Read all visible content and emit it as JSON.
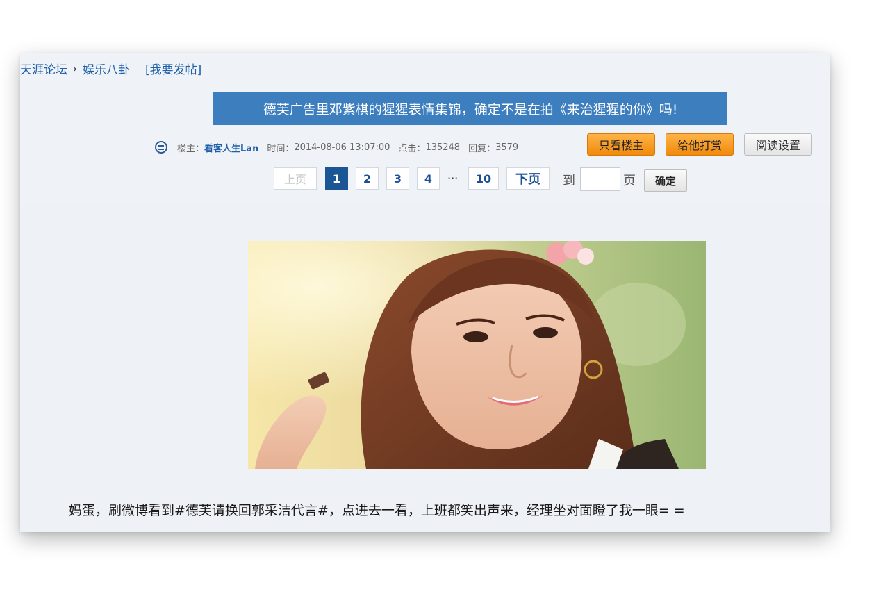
{
  "breadcrumb": {
    "forum": "天涯论坛",
    "separator": "›",
    "board": "娱乐八卦",
    "post_link": "[我要发帖]"
  },
  "post": {
    "title": "德芙广告里邓紫棋的猩猩表情集锦，确定不是在拍《来治猩猩的你》吗!",
    "author_label": "楼主：",
    "author": "看客人生Lan",
    "time_label": "时间：",
    "time": "2014-08-06 13:07:00",
    "clicks_label": "点击：",
    "clicks": "135248",
    "replies_label": "回复：",
    "replies": "3579",
    "body_text": "妈蛋，刷微博看到#德芙请换回郭采洁代言#，点进去一看，上班都笑出声来，经理坐对面瞪了我一眼= ="
  },
  "actions": {
    "only_author": "只看楼主",
    "reward": "给他打赏",
    "read_settings": "阅读设置"
  },
  "pagination": {
    "prev": "上页",
    "pages": [
      "1",
      "2",
      "3",
      "4"
    ],
    "ellipsis": "···",
    "last": "10",
    "next": "下页",
    "goto_label": "到",
    "page_unit": "页",
    "confirm": "确定",
    "current": "1"
  },
  "colors": {
    "accent": "#3d7ebf",
    "link": "#1d5fa8",
    "orange_button": "#f39a1f",
    "active_page": "#1a5596",
    "card_bg": "#eef1f5"
  }
}
